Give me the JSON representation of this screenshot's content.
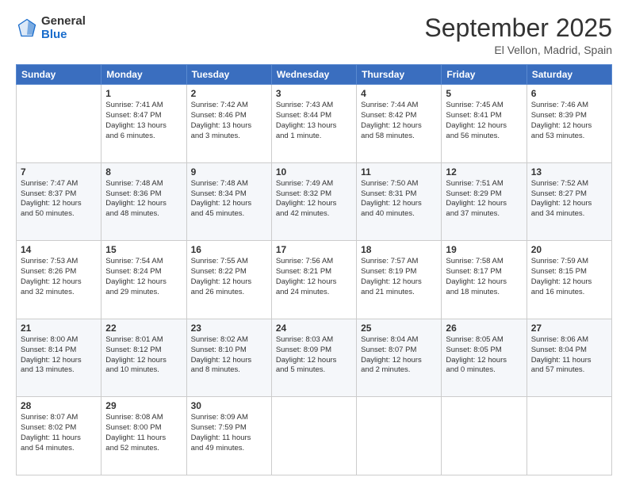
{
  "header": {
    "logo_line1": "General",
    "logo_line2": "Blue",
    "month": "September 2025",
    "location": "El Vellon, Madrid, Spain"
  },
  "days_of_week": [
    "Sunday",
    "Monday",
    "Tuesday",
    "Wednesday",
    "Thursday",
    "Friday",
    "Saturday"
  ],
  "weeks": [
    [
      {
        "day": "",
        "info": ""
      },
      {
        "day": "1",
        "info": "Sunrise: 7:41 AM\nSunset: 8:47 PM\nDaylight: 13 hours\nand 6 minutes."
      },
      {
        "day": "2",
        "info": "Sunrise: 7:42 AM\nSunset: 8:46 PM\nDaylight: 13 hours\nand 3 minutes."
      },
      {
        "day": "3",
        "info": "Sunrise: 7:43 AM\nSunset: 8:44 PM\nDaylight: 13 hours\nand 1 minute."
      },
      {
        "day": "4",
        "info": "Sunrise: 7:44 AM\nSunset: 8:42 PM\nDaylight: 12 hours\nand 58 minutes."
      },
      {
        "day": "5",
        "info": "Sunrise: 7:45 AM\nSunset: 8:41 PM\nDaylight: 12 hours\nand 56 minutes."
      },
      {
        "day": "6",
        "info": "Sunrise: 7:46 AM\nSunset: 8:39 PM\nDaylight: 12 hours\nand 53 minutes."
      }
    ],
    [
      {
        "day": "7",
        "info": "Sunrise: 7:47 AM\nSunset: 8:37 PM\nDaylight: 12 hours\nand 50 minutes."
      },
      {
        "day": "8",
        "info": "Sunrise: 7:48 AM\nSunset: 8:36 PM\nDaylight: 12 hours\nand 48 minutes."
      },
      {
        "day": "9",
        "info": "Sunrise: 7:48 AM\nSunset: 8:34 PM\nDaylight: 12 hours\nand 45 minutes."
      },
      {
        "day": "10",
        "info": "Sunrise: 7:49 AM\nSunset: 8:32 PM\nDaylight: 12 hours\nand 42 minutes."
      },
      {
        "day": "11",
        "info": "Sunrise: 7:50 AM\nSunset: 8:31 PM\nDaylight: 12 hours\nand 40 minutes."
      },
      {
        "day": "12",
        "info": "Sunrise: 7:51 AM\nSunset: 8:29 PM\nDaylight: 12 hours\nand 37 minutes."
      },
      {
        "day": "13",
        "info": "Sunrise: 7:52 AM\nSunset: 8:27 PM\nDaylight: 12 hours\nand 34 minutes."
      }
    ],
    [
      {
        "day": "14",
        "info": "Sunrise: 7:53 AM\nSunset: 8:26 PM\nDaylight: 12 hours\nand 32 minutes."
      },
      {
        "day": "15",
        "info": "Sunrise: 7:54 AM\nSunset: 8:24 PM\nDaylight: 12 hours\nand 29 minutes."
      },
      {
        "day": "16",
        "info": "Sunrise: 7:55 AM\nSunset: 8:22 PM\nDaylight: 12 hours\nand 26 minutes."
      },
      {
        "day": "17",
        "info": "Sunrise: 7:56 AM\nSunset: 8:21 PM\nDaylight: 12 hours\nand 24 minutes."
      },
      {
        "day": "18",
        "info": "Sunrise: 7:57 AM\nSunset: 8:19 PM\nDaylight: 12 hours\nand 21 minutes."
      },
      {
        "day": "19",
        "info": "Sunrise: 7:58 AM\nSunset: 8:17 PM\nDaylight: 12 hours\nand 18 minutes."
      },
      {
        "day": "20",
        "info": "Sunrise: 7:59 AM\nSunset: 8:15 PM\nDaylight: 12 hours\nand 16 minutes."
      }
    ],
    [
      {
        "day": "21",
        "info": "Sunrise: 8:00 AM\nSunset: 8:14 PM\nDaylight: 12 hours\nand 13 minutes."
      },
      {
        "day": "22",
        "info": "Sunrise: 8:01 AM\nSunset: 8:12 PM\nDaylight: 12 hours\nand 10 minutes."
      },
      {
        "day": "23",
        "info": "Sunrise: 8:02 AM\nSunset: 8:10 PM\nDaylight: 12 hours\nand 8 minutes."
      },
      {
        "day": "24",
        "info": "Sunrise: 8:03 AM\nSunset: 8:09 PM\nDaylight: 12 hours\nand 5 minutes."
      },
      {
        "day": "25",
        "info": "Sunrise: 8:04 AM\nSunset: 8:07 PM\nDaylight: 12 hours\nand 2 minutes."
      },
      {
        "day": "26",
        "info": "Sunrise: 8:05 AM\nSunset: 8:05 PM\nDaylight: 12 hours\nand 0 minutes."
      },
      {
        "day": "27",
        "info": "Sunrise: 8:06 AM\nSunset: 8:04 PM\nDaylight: 11 hours\nand 57 minutes."
      }
    ],
    [
      {
        "day": "28",
        "info": "Sunrise: 8:07 AM\nSunset: 8:02 PM\nDaylight: 11 hours\nand 54 minutes."
      },
      {
        "day": "29",
        "info": "Sunrise: 8:08 AM\nSunset: 8:00 PM\nDaylight: 11 hours\nand 52 minutes."
      },
      {
        "day": "30",
        "info": "Sunrise: 8:09 AM\nSunset: 7:59 PM\nDaylight: 11 hours\nand 49 minutes."
      },
      {
        "day": "",
        "info": ""
      },
      {
        "day": "",
        "info": ""
      },
      {
        "day": "",
        "info": ""
      },
      {
        "day": "",
        "info": ""
      }
    ]
  ]
}
